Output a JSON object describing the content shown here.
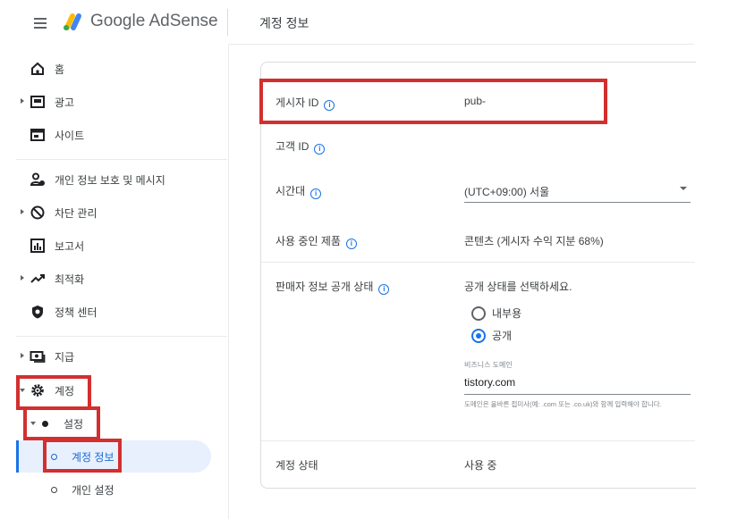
{
  "header": {
    "brand": "Google AdSense",
    "page_title": "계정 정보"
  },
  "sidebar": {
    "items": [
      {
        "label": "홈",
        "icon": "home-icon"
      },
      {
        "label": "광고",
        "icon": "ads-icon"
      },
      {
        "label": "사이트",
        "icon": "sites-icon"
      },
      {
        "label": "개인 정보 보호 및 메시지",
        "icon": "privacy-icon"
      },
      {
        "label": "차단 관리",
        "icon": "block-icon"
      },
      {
        "label": "보고서",
        "icon": "reports-icon"
      },
      {
        "label": "최적화",
        "icon": "optimization-icon"
      },
      {
        "label": "정책 센터",
        "icon": "policy-icon"
      },
      {
        "label": "지급",
        "icon": "payments-icon"
      },
      {
        "label": "계정",
        "icon": "account-gear-icon"
      },
      {
        "label": "설정"
      },
      {
        "label": "계정 정보"
      },
      {
        "label": "개인 설정"
      }
    ]
  },
  "account": {
    "publisher_id_label": "게시자 ID",
    "publisher_id_value": "pub-",
    "customer_id_label": "고객 ID",
    "timezone_label": "시간대",
    "timezone_value": "(UTC+09:00) 서울",
    "products_label": "사용 중인 제품",
    "products_value": "콘텐츠 (게시자 수익 지분 68%)",
    "seller_label": "판매자 정보 공개 상태",
    "seller_prompt": "공개 상태를 선택하세요.",
    "radio_internal": "내부용",
    "radio_public": "공개",
    "radio_selected": "공개",
    "business_domain_label": "비즈니스 도메인",
    "business_domain_value": "tistory.com",
    "business_domain_help": "도메인은 올바른 접미사(예: .com 또는 .co.uk)와 함께 입력해야 합니다.",
    "status_label": "계정 상태",
    "status_value": "사용 중"
  },
  "colors": {
    "accent": "#1a73e8",
    "highlight": "#d32f2f",
    "active_bg": "#e8f0fe"
  }
}
